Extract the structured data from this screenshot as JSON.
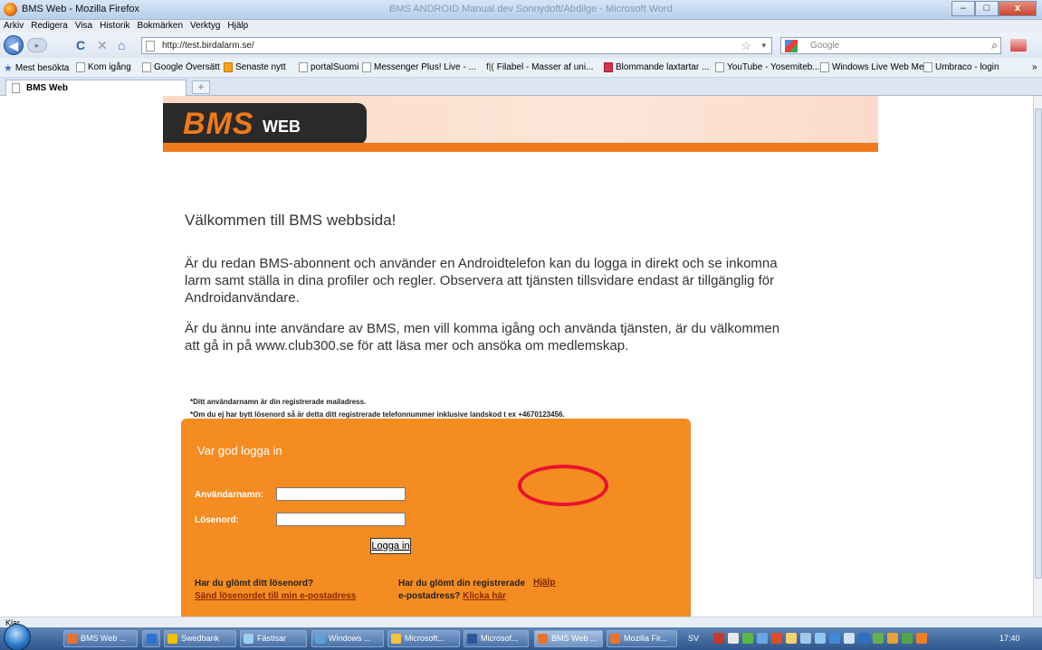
{
  "window": {
    "title": "BMS Web - Mozilla Firefox",
    "background_title": "BMS ANDROID Manual dev Sonnydoft/Abdilge - Microsoft Word",
    "buttons": {
      "minimize": "–",
      "maximize": "□",
      "close": "x"
    }
  },
  "menu": [
    "Arkiv",
    "Redigera",
    "Visa",
    "Historik",
    "Bokmärken",
    "Verktyg",
    "Hjälp"
  ],
  "nav": {
    "back": "◀",
    "forward": "▸",
    "reload": "C",
    "stop": "✕",
    "home": "⌂",
    "url": "http://test.birdalarm.se/",
    "search_placeholder": "Google",
    "star": "☆",
    "dropdown": "▾",
    "search_icon": "⌕"
  },
  "bookmarks": [
    "Mest besökta",
    "Kom igång",
    "Google Översätt",
    "Senaste nytt",
    "portalSuomi",
    "Messenger Plus! Live - ...",
    "Filabel - Masser af uni...",
    "Blommande laxtartar ...",
    "YouTube - Yosemiteb...",
    "Windows Live Web Me...",
    "Umbraco - login",
    "»"
  ],
  "tab": {
    "label": "BMS Web",
    "new_tab": "+"
  },
  "page": {
    "logo_bms": "BMS",
    "logo_web": "WEB",
    "welcome": "Välkommen till BMS webbsida!",
    "paragraph1": "Är du redan BMS-abonnent och använder en Androidtelefon kan du logga in direkt och se inkomna larm samt ställa in dina profiler och regler. Observera att tjänsten tillsvidare endast är tillgänglig för Androidanvändare.",
    "paragraph2": "Är du ännu inte användare av BMS, men vill komma igång och använda tjänsten, är du välkommen att gå in på www.club300.se för att läsa mer och ansöka om medlemskap.",
    "note1": "*Ditt användarnamn är din registrerade mailadress.",
    "note2": "*Om du ej har bytt lösenord så är detta ditt registrerade telefonnummer inklusive landskod t ex +4670123456.",
    "login": {
      "heading": "Var god logga in",
      "username_label": "Användarnamn:",
      "password_label": "Lösenord:",
      "username_value": "",
      "password_value": "",
      "button": "Logga in",
      "forgot_pw_q": "Har du glömt ditt lösenord?",
      "forgot_pw_link": "Sänd lösenordet till min e-postadress",
      "forgot_email_q": "Har du glömt din registrerade",
      "forgot_email_q2": "e-postadress?",
      "forgot_email_link": "Klicka här",
      "help": "Hjälp"
    }
  },
  "status": "Klar",
  "taskbar": {
    "items": [
      "BMS Web ...",
      "",
      "Swedbank",
      "Fästisar",
      "Windows ...",
      "Microsoft...",
      "Microsof...",
      "BMS Web ...",
      "Mozilla Fir..."
    ],
    "lang": "SV",
    "clock": "17:40"
  },
  "colors": {
    "accent_orange": "#f48c22",
    "highlight_circle": "#e8132c"
  }
}
